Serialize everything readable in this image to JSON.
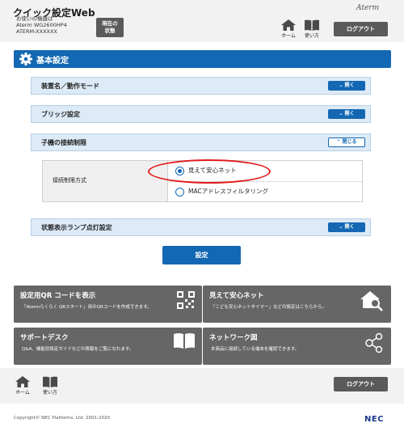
{
  "header": {
    "app_title": "クイック設定Web",
    "model_lines": [
      "お使いの機器は",
      "Aterm WG2600HP4",
      "ATERM-XXXXXX"
    ],
    "status_button_lines": [
      "現在の",
      "状態"
    ],
    "brand": "Aterm",
    "home_label": "ホーム",
    "manual_label": "使い方",
    "logout_label": "ログアウト"
  },
  "section": {
    "title": "基本設定"
  },
  "accordions": [
    {
      "label": "装置名／動作モード",
      "button": "開く",
      "state": "closed"
    },
    {
      "label": "ブリッジ設定",
      "button": "開く",
      "state": "closed"
    },
    {
      "label": "子機の接続制限",
      "button": "閉じる",
      "state": "open"
    },
    {
      "label": "状態表示ランプ点灯設定",
      "button": "開く",
      "state": "closed"
    }
  ],
  "connection_limit": {
    "field_label": "接続制限方式",
    "options": [
      {
        "label": "見えて安心ネット",
        "selected": true
      },
      {
        "label": "MACアドレスフィルタリング",
        "selected": false
      }
    ]
  },
  "submit_label": "設定",
  "tiles": [
    {
      "title": "設定用QR コードを表示",
      "desc": "「Atermらくらく QRスタート」用のQRコードを作成できます。",
      "icon": "qr-code-icon"
    },
    {
      "title": "見えて安心ネット",
      "desc": "「こども安心ネットタイマー」などの設定はこちらから。",
      "icon": "home-search-icon"
    },
    {
      "title": "サポートデスク",
      "desc": "Q&A、機能別設定ガイドなどの情報をご覧になれます。",
      "icon": "book-icon"
    },
    {
      "title": "ネットワーク図",
      "desc": "本商品に接続している端末を確認できます。",
      "icon": "network-icon"
    }
  ],
  "footer": {
    "home_label": "ホーム",
    "manual_label": "使い方",
    "logout_label": "ログアウト",
    "copyright": "Copyright© NEC Platforms, Ltd. 2001-2020",
    "logo": "NEC"
  },
  "colors": {
    "accent_blue": "#1468b3",
    "tile_gray": "#666666",
    "highlight_red": "#e11c1c"
  }
}
